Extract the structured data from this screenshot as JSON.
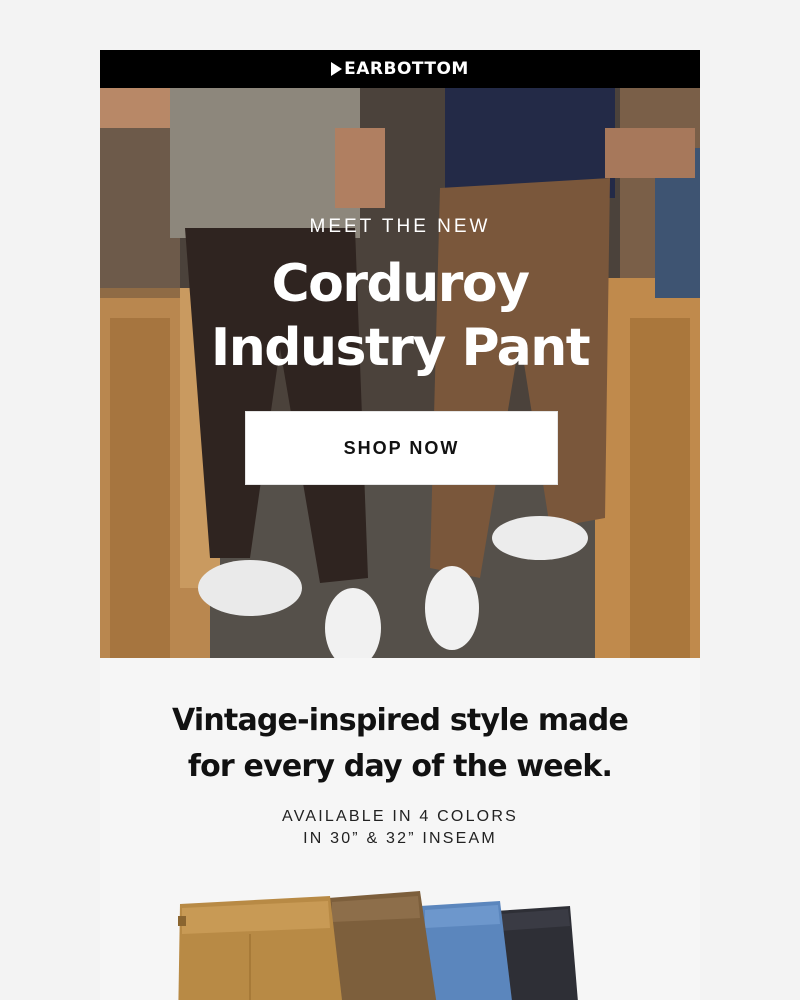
{
  "brand": {
    "logo_text": "EARBOTTOM",
    "logo_icon": "bearbottom-b-mark"
  },
  "hero": {
    "eyebrow": "MEET THE NEW",
    "headline_line1": "Corduroy",
    "headline_line2": "Industry Pant",
    "cta_label": "SHOP NOW"
  },
  "details": {
    "subhead_line1": "Vintage-inspired style made",
    "subhead_line2": "for every day of the week.",
    "availability_line1": "AVAILABLE IN 4 COLORS",
    "availability_line2": "IN 30” & 32” INSEAM"
  },
  "colors": {
    "topbar": "#000000",
    "cta_bg": "#ffffff",
    "swatches": [
      "#b88a45",
      "#7d5f3c",
      "#5b86bd",
      "#2e2f36"
    ]
  }
}
